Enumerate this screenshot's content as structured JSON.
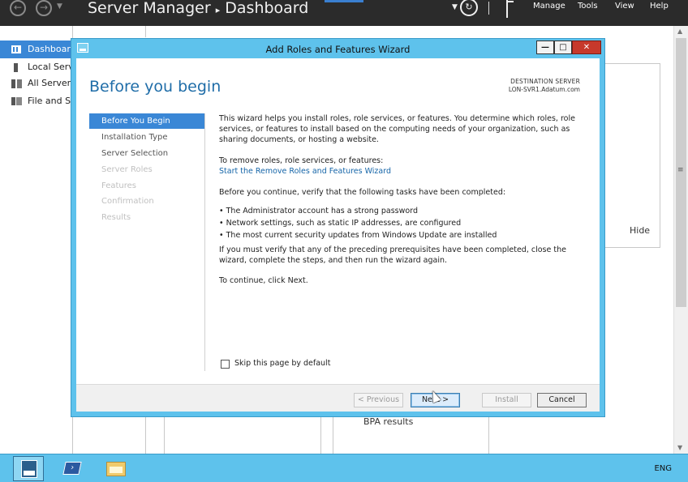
{
  "server_manager": {
    "title": "Server Manager",
    "breadcrumb_separator": "▸",
    "breadcrumb": "Dashboard",
    "menus": [
      "Manage",
      "Tools",
      "View",
      "Help"
    ],
    "nav_items": [
      {
        "label": "Dashboard",
        "icon": "dashboard-icon",
        "selected": true
      },
      {
        "label": "Local Server",
        "icon": "server-icon",
        "selected": false
      },
      {
        "label": "All Servers",
        "icon": "servers-icon",
        "selected": false
      },
      {
        "label": "File and Storage Services",
        "icon": "storage-icon",
        "selected": false
      }
    ],
    "background": {
      "hide_label": "Hide",
      "bpa_label": "BPA results"
    }
  },
  "wizard": {
    "title": "Add Roles and Features Wizard",
    "heading": "Before you begin",
    "destination_label": "DESTINATION SERVER",
    "destination_server": "LON-SVR1.Adatum.com",
    "steps": [
      {
        "label": "Before You Begin",
        "state": "active"
      },
      {
        "label": "Installation Type",
        "state": "enabled"
      },
      {
        "label": "Server Selection",
        "state": "enabled"
      },
      {
        "label": "Server Roles",
        "state": "disabled"
      },
      {
        "label": "Features",
        "state": "disabled"
      },
      {
        "label": "Confirmation",
        "state": "disabled"
      },
      {
        "label": "Results",
        "state": "disabled"
      }
    ],
    "intro": "This wizard helps you install roles, role services, or features. You determine which roles, role services, or features to install based on the computing needs of your organization, such as sharing documents, or hosting a website.",
    "remove_text": "To remove roles, role services, or features:",
    "remove_link": "Start the Remove Roles and Features Wizard",
    "verify_text": "Before you continue, verify that the following tasks have been completed:",
    "bullets": [
      "• The Administrator account has a strong password",
      "• Network settings, such as static IP addresses, are configured",
      "• The most current security updates from Windows Update are installed"
    ],
    "prereq_text": "If you must verify that any of the preceding prerequisites have been completed, close the wizard, complete the steps, and then run the wizard again.",
    "continue_text": "To continue, click Next.",
    "skip_label": "Skip this page by default",
    "skip_checked": false,
    "buttons": {
      "previous": "< Previous",
      "next": "Next >",
      "install": "Install",
      "cancel": "Cancel"
    }
  },
  "taskbar": {
    "language": "ENG"
  },
  "colors": {
    "accent": "#3a87d6",
    "wizard_frame": "#5ec2ec",
    "header_bg": "#2b2b2b",
    "heading": "#1f6da8",
    "link": "#1565a8"
  }
}
